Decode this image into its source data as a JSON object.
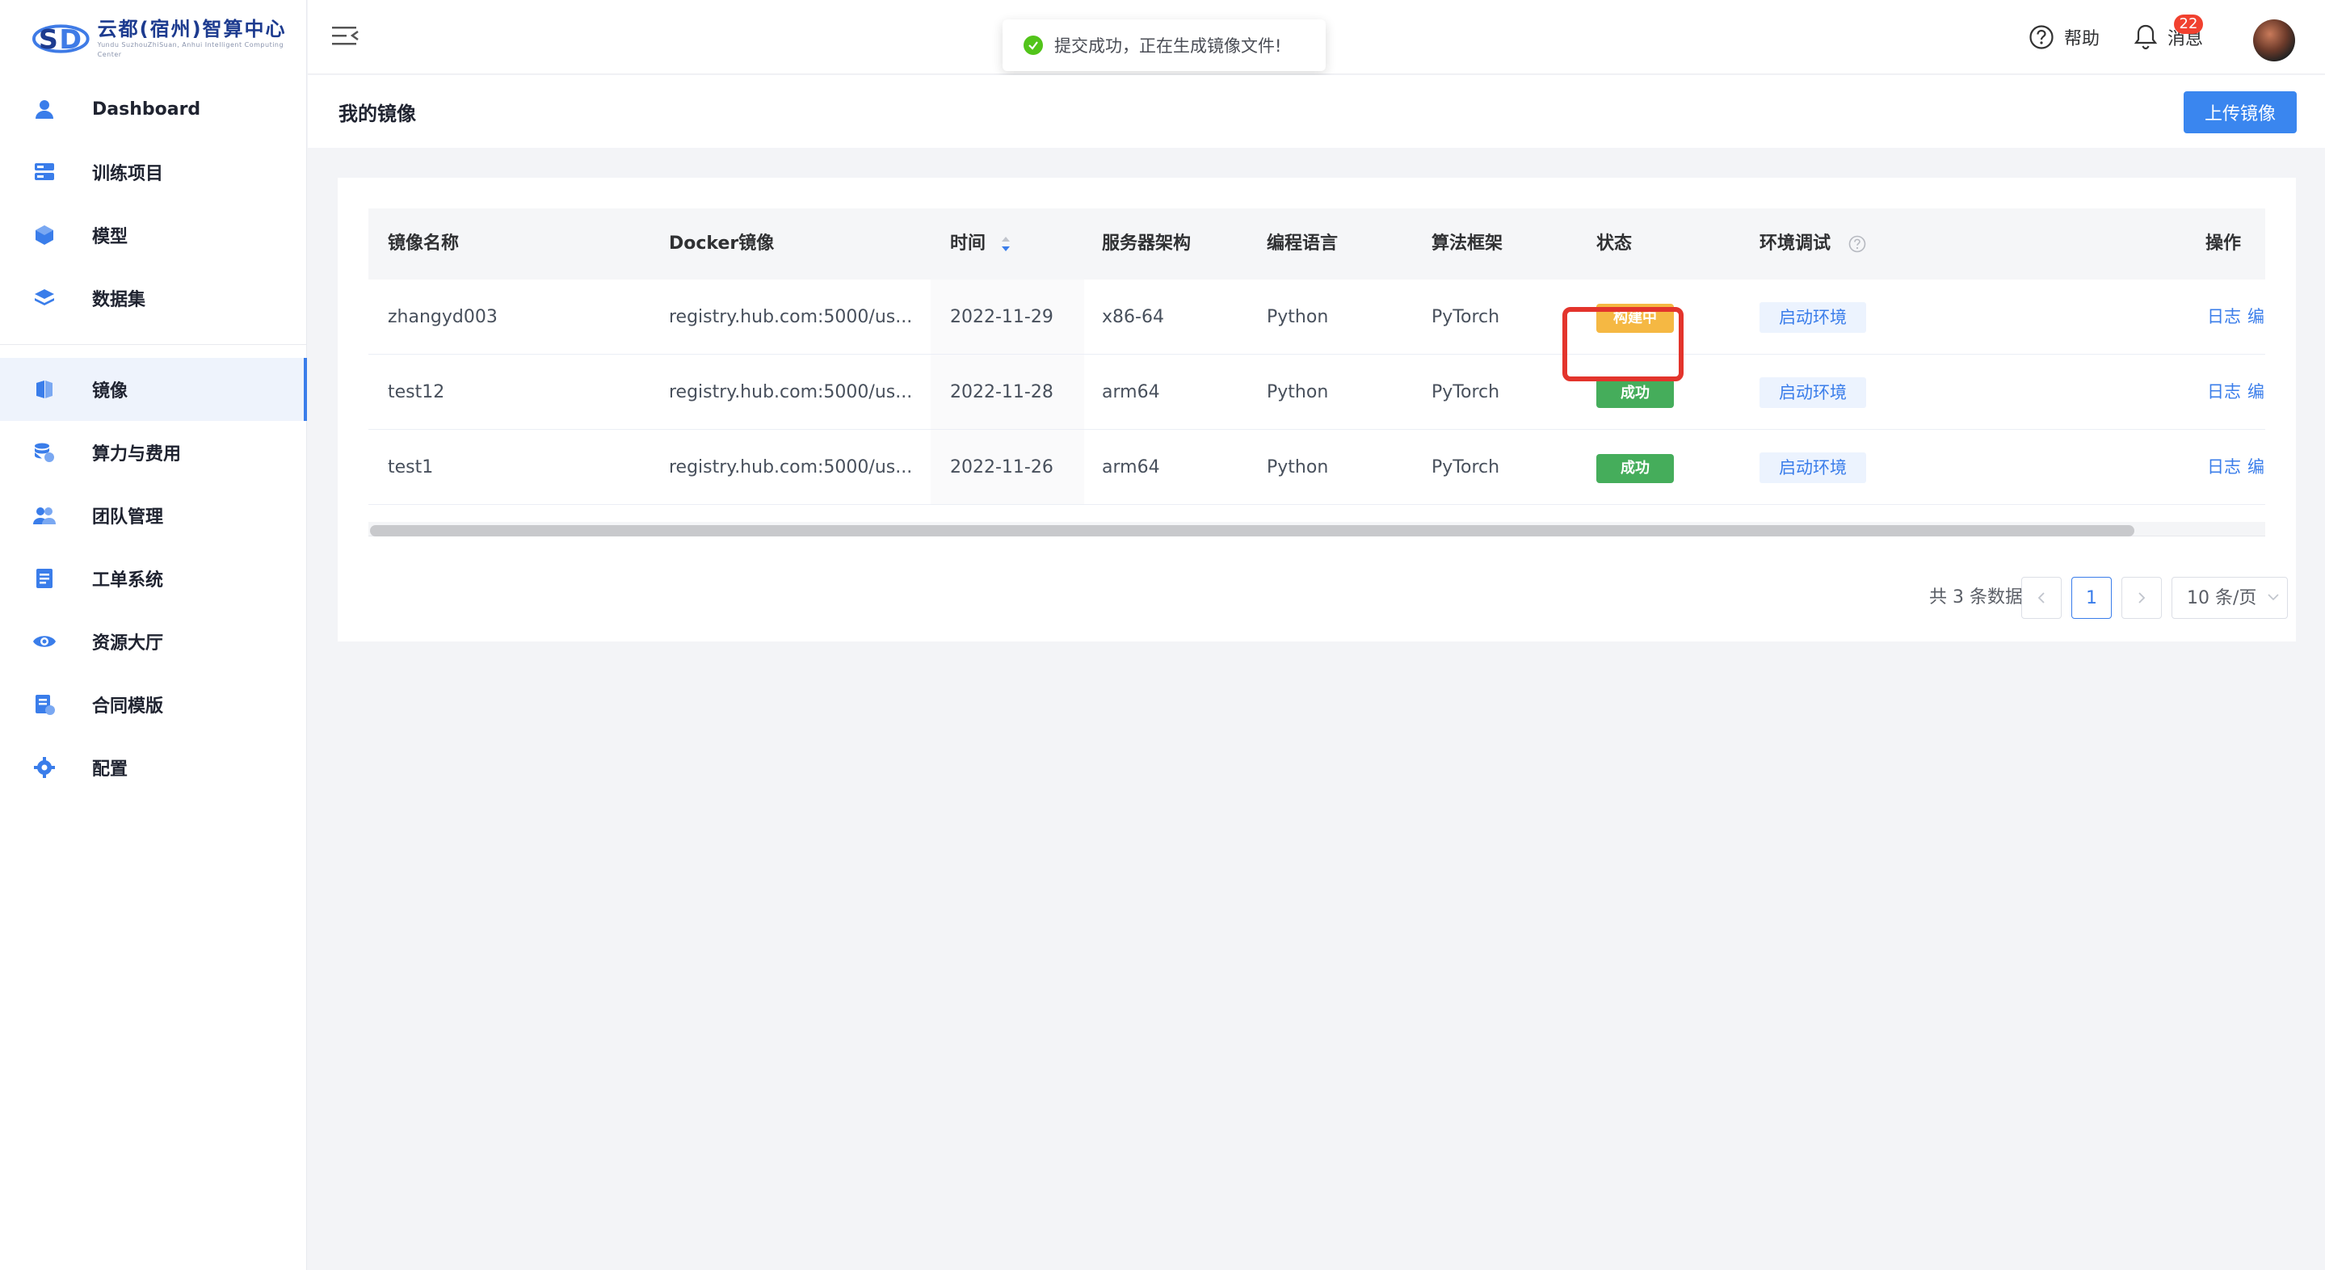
{
  "brand": {
    "title": "云都(宿州)智算中心",
    "subtitle": "Yundu SuzhouZhiSuan, Anhui Intelligent Computing Center"
  },
  "sidebar": {
    "items": [
      {
        "label": "Dashboard",
        "icon": "user-icon"
      },
      {
        "label": "训练项目",
        "icon": "server-icon"
      },
      {
        "label": "模型",
        "icon": "cube-icon"
      },
      {
        "label": "数据集",
        "icon": "layers-icon"
      },
      {
        "label": "镜像",
        "icon": "image-icon",
        "active": true
      },
      {
        "label": "算力与费用",
        "icon": "billing-icon"
      },
      {
        "label": "团队管理",
        "icon": "team-icon"
      },
      {
        "label": "工单系统",
        "icon": "ticket-icon"
      },
      {
        "label": "资源大厅",
        "icon": "eye-icon"
      },
      {
        "label": "合同模版",
        "icon": "contract-icon"
      },
      {
        "label": "配置",
        "icon": "gear-icon"
      }
    ]
  },
  "header": {
    "toast": "提交成功，正在生成镜像文件!",
    "help_label": "帮助",
    "messages_label": "消息",
    "messages_count": "22"
  },
  "page": {
    "title": "我的镜像",
    "upload_label": "上传镜像"
  },
  "table": {
    "columns": [
      "镜像名称",
      "Docker镜像",
      "时间",
      "服务器架构",
      "编程语言",
      "算法框架",
      "状态",
      "环境调试",
      "操作"
    ],
    "rows": [
      {
        "name": "zhangyd003",
        "docker": "registry.hub.com:5000/us...",
        "time": "2022-11-29",
        "arch": "x86-64",
        "lang": "Python",
        "framework": "PyTorch",
        "status": "构建中",
        "status_type": "building",
        "env": "启动环境",
        "op_log": "日志",
        "op_edit": "编"
      },
      {
        "name": "test12",
        "docker": "registry.hub.com:5000/us...",
        "time": "2022-11-28",
        "arch": "arm64",
        "lang": "Python",
        "framework": "PyTorch",
        "status": "成功",
        "status_type": "success",
        "env": "启动环境",
        "op_log": "日志",
        "op_edit": "编"
      },
      {
        "name": "test1",
        "docker": "registry.hub.com:5000/us...",
        "time": "2022-11-26",
        "arch": "arm64",
        "lang": "Python",
        "framework": "PyTorch",
        "status": "成功",
        "status_type": "success",
        "env": "启动环境",
        "op_log": "日志",
        "op_edit": "编"
      }
    ]
  },
  "pagination": {
    "total": "共 3 条数据",
    "current_page": "1",
    "page_size": "10 条/页"
  },
  "colors": {
    "accent": "#3a86ef",
    "building": "#f5b843",
    "success": "#45ad5b",
    "highlight": "#e3342c"
  }
}
